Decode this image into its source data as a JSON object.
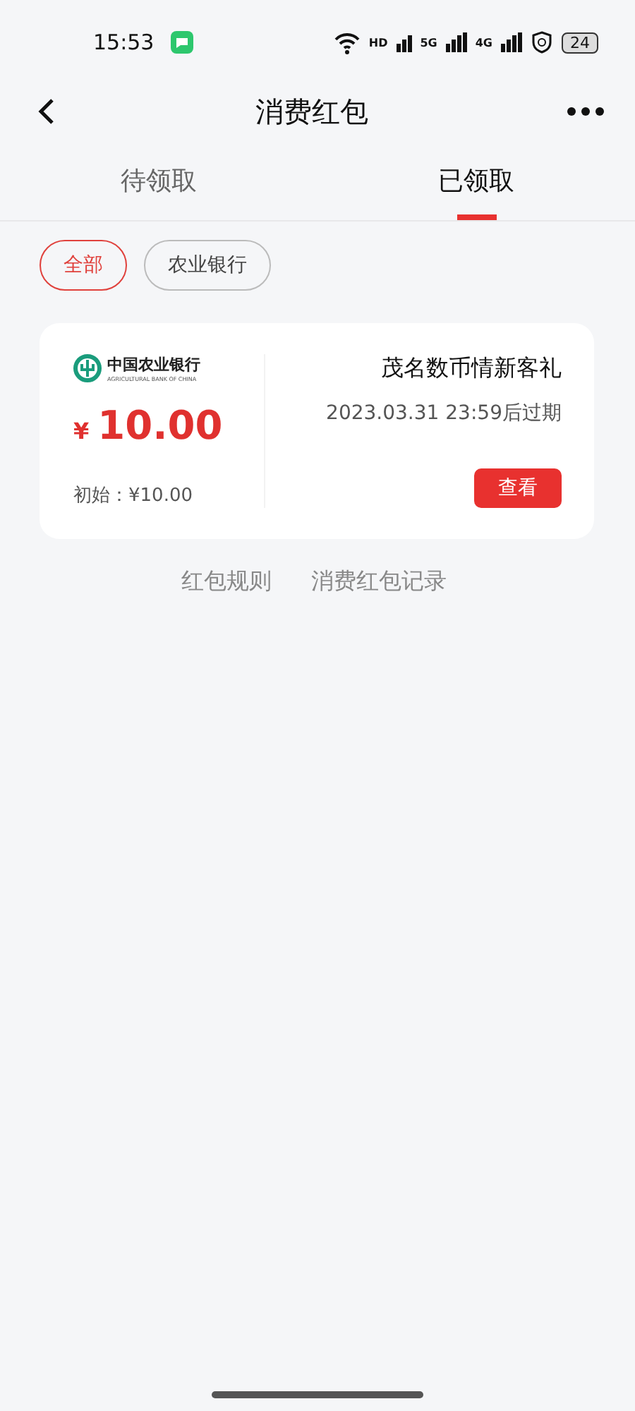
{
  "status_bar": {
    "time": "15:53",
    "network_labels": [
      "HD",
      "5G",
      "4G"
    ],
    "battery": "24"
  },
  "header": {
    "title": "消费红包"
  },
  "tabs": [
    {
      "label": "待领取",
      "selected": false
    },
    {
      "label": "已领取",
      "selected": true
    }
  ],
  "filters": [
    {
      "label": "全部",
      "selected": true
    },
    {
      "label": "农业银行",
      "selected": false
    }
  ],
  "coupons": [
    {
      "bank_name": "中国农业银行",
      "bank_name_en": "AGRICULTURAL BANK OF CHINA",
      "currency": "¥",
      "amount": "10.00",
      "initial": "初始：¥10.00",
      "title": "茂名数币情新客礼",
      "expiry": "2023.03.31 23:59后过期",
      "action": "查看"
    }
  ],
  "links": [
    "红包规则",
    "消费红包记录"
  ]
}
